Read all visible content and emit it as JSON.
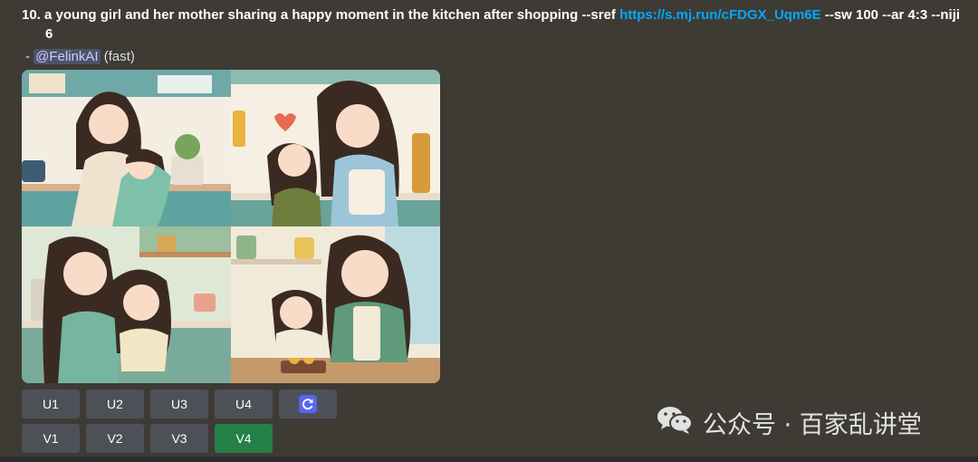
{
  "prompt": {
    "prefix": "10. a young girl and her mother sharing a happy moment in the kitchen after shopping --sref ",
    "link": "https://s.mj.run/cFDGX_Uqm6E",
    "suffix": " --sw 100 --ar 4:3 --niji",
    "continuation": "6"
  },
  "mention": {
    "dash": "- ",
    "user": "@FelinkAI",
    "mode": " (fast)"
  },
  "upscale_buttons": [
    "U1",
    "U2",
    "U3",
    "U4"
  ],
  "variation_buttons": [
    "V1",
    "V2",
    "V3",
    "V4"
  ],
  "active_button": "V4",
  "refresh_icon": "refresh-icon",
  "watermark": {
    "icon": "wechat-icon",
    "text": "公众号 · 百家乱讲堂"
  },
  "colors": {
    "background": "#3e3b35",
    "link": "#00a8fc",
    "button": "#4e5058",
    "button_active": "#248046",
    "refresh": "#5865f2"
  }
}
